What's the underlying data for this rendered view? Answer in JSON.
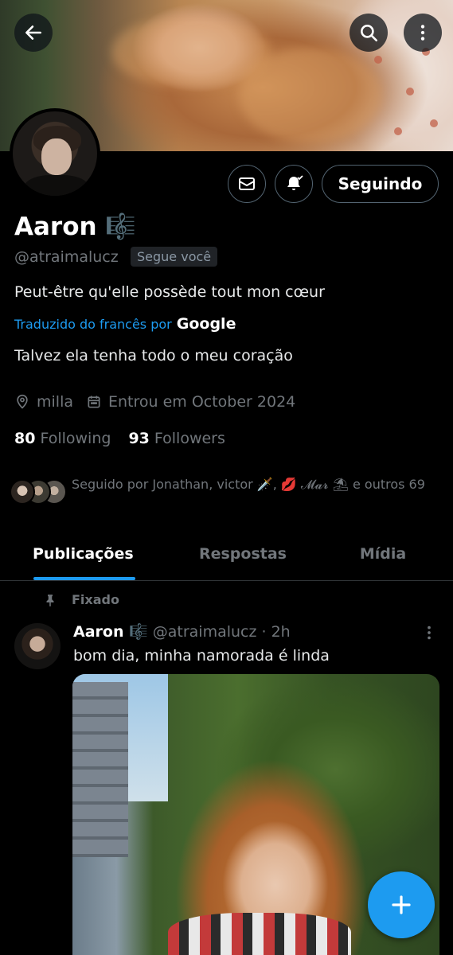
{
  "profile": {
    "name": "Aaron 🎼",
    "handle": "@atraimalucz",
    "follows_you": "Segue você",
    "bio_original": "Peut-être qu'elle possède tout mon cœur",
    "translated_label": "Traduzido do francês por",
    "translated_by": "Google",
    "bio_translated": "Talvez ela tenha todo o meu coração",
    "location": "milla",
    "joined": "Entrou em October 2024",
    "following_count": "80",
    "following_label": "Following",
    "followers_count": "93",
    "followers_label": "Followers",
    "followed_by": "Seguido por Jonathan, victor 🗡️, 💋 𝓜𝓪𝓻 ⛱ e outros 69",
    "follow_button": "Seguindo"
  },
  "tabs": [
    {
      "label": "Publicações",
      "active": true
    },
    {
      "label": "Respostas",
      "active": false
    },
    {
      "label": "Mídia",
      "active": false
    }
  ],
  "post": {
    "pinned_label": "Fixado",
    "author": "Aaron 🎼",
    "handle_time": "@atraimalucz · 2h",
    "text": "bom dia, minha namorada é linda"
  },
  "icons": {
    "back": "arrow-left-icon",
    "search": "search-icon",
    "more": "more-vertical-icon",
    "message": "envelope-icon",
    "notify": "bell-check-icon",
    "location": "location-pin-icon",
    "calendar": "calendar-icon",
    "pin": "pin-icon",
    "compose": "plus-icon"
  },
  "colors": {
    "accent": "#1d9bf0",
    "background": "#000000",
    "muted_text": "#71767b"
  }
}
